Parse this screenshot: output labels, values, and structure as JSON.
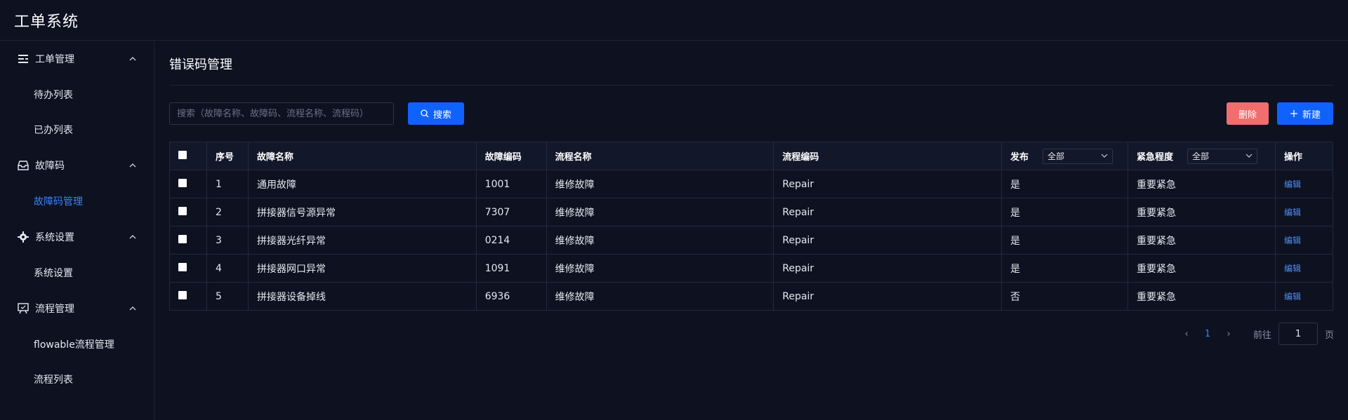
{
  "app": {
    "title": "工单系统"
  },
  "sidebar": {
    "groups": [
      {
        "label": "工单管理",
        "icon": "list-icon",
        "items": [
          {
            "label": "待办列表"
          },
          {
            "label": "已办列表"
          }
        ]
      },
      {
        "label": "故障码",
        "icon": "inbox-icon",
        "items": [
          {
            "label": "故障码管理",
            "active": true
          }
        ]
      },
      {
        "label": "系统设置",
        "icon": "gear-icon",
        "items": [
          {
            "label": "系统设置"
          }
        ]
      },
      {
        "label": "流程管理",
        "icon": "presentation-icon",
        "items": [
          {
            "label": "flowable流程管理"
          },
          {
            "label": "流程列表"
          }
        ]
      }
    ]
  },
  "main": {
    "title": "错误码管理",
    "search": {
      "placeholder": "搜索（故障名称、故障码、流程名称、流程码）",
      "value": "",
      "button_label": "搜索"
    },
    "actions": {
      "delete_label": "删除",
      "new_label": "新建"
    }
  },
  "table": {
    "headers": {
      "index": "序号",
      "fault_name": "故障名称",
      "fault_code": "故障编码",
      "flow_name": "流程名称",
      "flow_code": "流程编码",
      "publish": "发布",
      "publish_filter": "全部",
      "urgency": "紧急程度",
      "urgency_filter": "全部",
      "ops": "操作"
    },
    "rows": [
      {
        "index": "1",
        "fault_name": "通用故障",
        "fault_code": "1001",
        "flow_name": "维修故障",
        "flow_code": "Repair",
        "publish": "是",
        "urgency": "重要紧急",
        "op": "编辑"
      },
      {
        "index": "2",
        "fault_name": "拼接器信号源异常",
        "fault_code": "7307",
        "flow_name": "维修故障",
        "flow_code": "Repair",
        "publish": "是",
        "urgency": "重要紧急",
        "op": "编辑"
      },
      {
        "index": "3",
        "fault_name": "拼接器光纤异常",
        "fault_code": "0214",
        "flow_name": "维修故障",
        "flow_code": "Repair",
        "publish": "是",
        "urgency": "重要紧急",
        "op": "编辑"
      },
      {
        "index": "4",
        "fault_name": "拼接器网口异常",
        "fault_code": "1091",
        "flow_name": "维修故障",
        "flow_code": "Repair",
        "publish": "是",
        "urgency": "重要紧急",
        "op": "编辑"
      },
      {
        "index": "5",
        "fault_name": "拼接器设备掉线",
        "fault_code": "6936",
        "flow_name": "维修故障",
        "flow_code": "Repair",
        "publish": "否",
        "urgency": "重要紧急",
        "op": "编辑"
      }
    ]
  },
  "pagination": {
    "prev": "‹",
    "current": "1",
    "next": "›",
    "goto_label": "前往",
    "goto_value": "1",
    "page_suffix": "页"
  },
  "colors": {
    "background": "#0d1120",
    "accent": "#0f62fe",
    "danger": "#f26d6d",
    "link": "#4f8ff7"
  }
}
